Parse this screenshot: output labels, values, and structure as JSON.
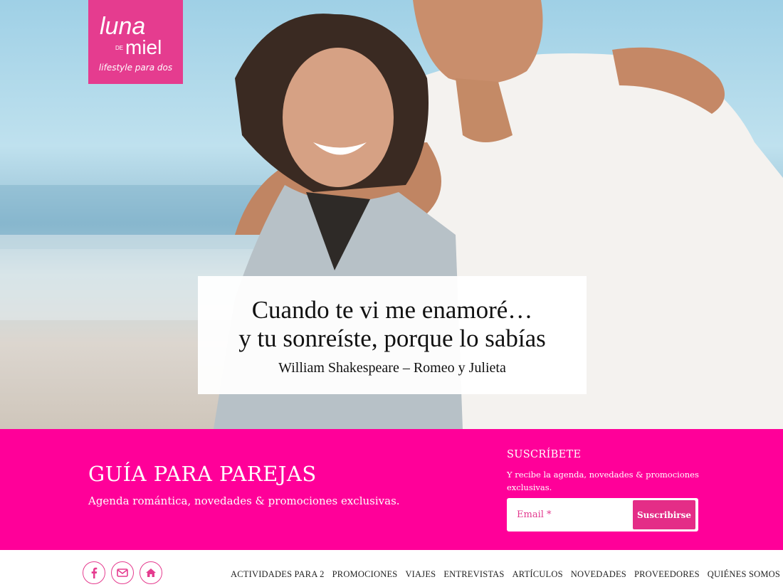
{
  "logo": {
    "brand_luna": "luna",
    "brand_de": "DE",
    "brand_miel": "miel",
    "tagline": "lifestyle para dos"
  },
  "hero": {
    "quote_line1": "Cuando te vi me enamoré…",
    "quote_line2": "y tu sonreíste, porque lo sabías",
    "quote_attribution": "William Shakespeare – Romeo y Julieta"
  },
  "band": {
    "title": "GUÍA PARA PAREJAS",
    "subtitle": "Agenda romántica, novedades & promociones exclusivas."
  },
  "subscribe": {
    "title": "SUSCRÍBETE",
    "text": "Y recibe la agenda, novedades & promociones exclusivas.",
    "email_placeholder": "Email *",
    "button_label": "Suscribirse"
  },
  "social": [
    {
      "icon": "facebook-icon"
    },
    {
      "icon": "envelope-icon"
    },
    {
      "icon": "home-icon"
    }
  ],
  "nav": {
    "items": [
      "ACTIVIDADES PARA 2",
      "PROMOCIONES",
      "VIAJES",
      "ENTREVISTAS",
      "ARTÍCULOS",
      "NOVEDADES",
      "PROVEEDORES",
      "QUIÉNES SOMOS"
    ]
  },
  "colors": {
    "brand_pink": "#e53c8f",
    "band_pink": "#ff0099",
    "button_pink": "#e42d87"
  }
}
